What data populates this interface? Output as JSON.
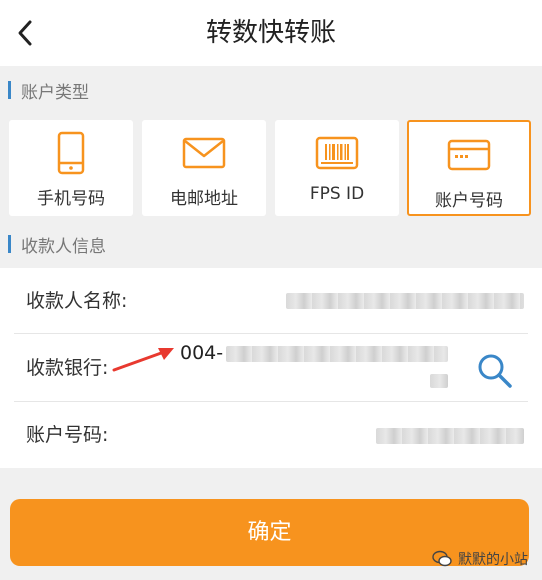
{
  "header": {
    "title": "转数快转账"
  },
  "sections": {
    "account_type": "账户类型",
    "payee_info": "收款人信息"
  },
  "account_types": [
    {
      "label": "手机号码",
      "icon": "phone-icon",
      "selected": false
    },
    {
      "label": "电邮地址",
      "icon": "mail-icon",
      "selected": false
    },
    {
      "label": "FPS ID",
      "icon": "barcode-id-icon",
      "selected": false
    },
    {
      "label": "账户号码",
      "icon": "card-icon",
      "selected": true
    }
  ],
  "payee": {
    "name_label": "收款人名称:",
    "bank_label": "收款银行:",
    "bank_value": "004-",
    "account_label": "账户号码:"
  },
  "confirm_label": "确定",
  "watermark": "默默的小站",
  "colors": {
    "accent": "#f7931e",
    "section_bar": "#3a87c8",
    "search_icon": "#3a87c8",
    "annotation_arrow": "#e8392f"
  }
}
